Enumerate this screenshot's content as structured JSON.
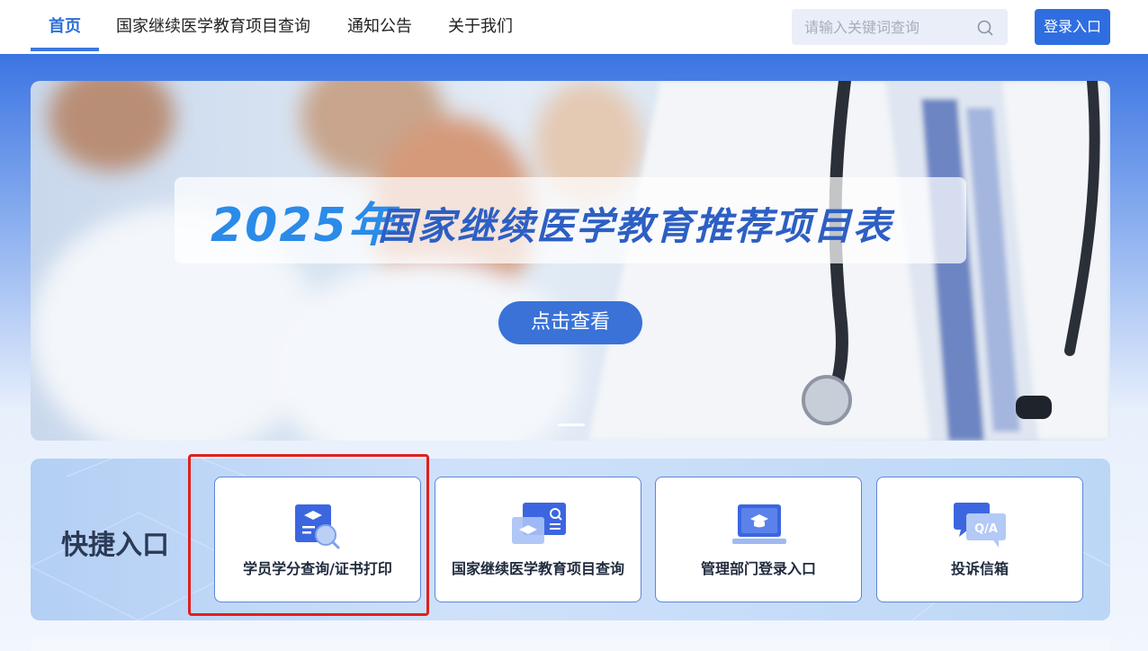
{
  "header": {
    "nav": [
      {
        "label": "首页",
        "active": true
      },
      {
        "label": "国家继续医学教育项目查询",
        "active": false
      },
      {
        "label": "通知公告",
        "active": false
      },
      {
        "label": "关于我们",
        "active": false
      }
    ],
    "search_placeholder": "请输入关键词查询",
    "login_label": "登录入口"
  },
  "banner": {
    "year": "2025年",
    "title": "国家继续医学教育推荐项目表",
    "button_label": "点击查看"
  },
  "quick_entry": {
    "title": "快捷入口",
    "cards": [
      {
        "label": "学员学分查询/证书打印",
        "icon": "credit-search-icon"
      },
      {
        "label": "国家继续医学教育项目查询",
        "icon": "project-search-icon"
      },
      {
        "label": "管理部门登录入口",
        "icon": "admin-login-icon"
      },
      {
        "label": "投诉信箱",
        "icon": "qa-complaint-icon"
      }
    ]
  },
  "colors": {
    "accent": "#2f6ee0",
    "highlight": "#e0201b"
  }
}
